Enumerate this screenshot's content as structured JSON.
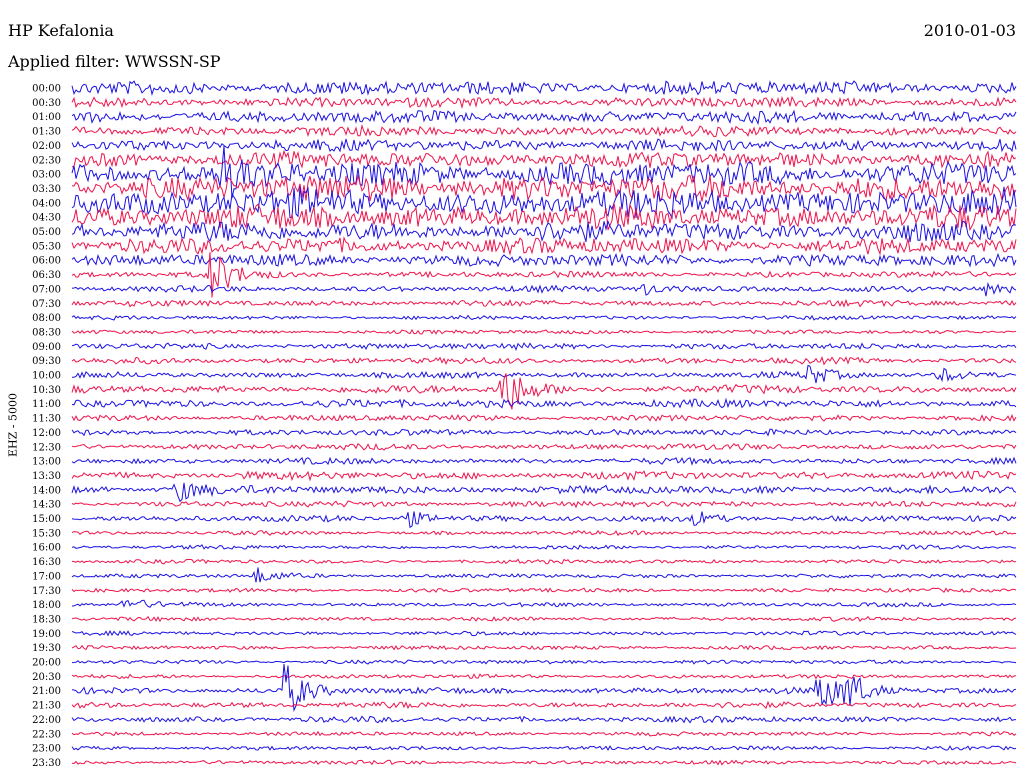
{
  "header": {
    "station": "HP Kefalonia",
    "date": "2010-01-03",
    "filter": "Applied filter: WWSSN-SP"
  },
  "channel_label": "EHZ - 5000",
  "colors": {
    "blue": "#1a10e6",
    "red": "#f0124a"
  },
  "chart_data": {
    "type": "line",
    "title": "HP Kefalonia",
    "date": "2010-01-03",
    "filter": "WWSSN-SP",
    "ylabel": "EHZ - 5000",
    "row_labels": [
      "00:00",
      "00:30",
      "01:00",
      "01:30",
      "02:00",
      "02:30",
      "03:00",
      "03:30",
      "04:00",
      "04:30",
      "05:00",
      "05:30",
      "06:00",
      "06:30",
      "07:00",
      "07:30",
      "08:00",
      "08:30",
      "09:00",
      "09:30",
      "10:00",
      "10:30",
      "11:00",
      "11:30",
      "12:00",
      "12:30",
      "13:00",
      "13:30",
      "14:00",
      "14:30",
      "15:00",
      "15:30",
      "16:00",
      "16:30",
      "17:00",
      "17:30",
      "18:00",
      "18:30",
      "19:00",
      "19:30",
      "20:00",
      "20:30",
      "21:00",
      "21:30",
      "22:00",
      "22:30",
      "23:00",
      "23:30"
    ],
    "row_noise_amplitude": [
      7,
      5,
      6,
      5,
      6,
      8,
      12,
      13,
      14,
      12,
      10,
      8,
      6,
      3,
      3,
      3,
      2,
      2,
      3,
      3,
      3,
      4,
      4,
      3,
      3,
      3,
      3,
      4,
      4,
      3,
      3,
      2,
      2,
      2,
      2,
      2,
      2,
      2,
      2,
      2,
      2,
      2,
      3,
      3,
      3,
      2,
      2,
      2
    ],
    "events": [
      {
        "row": 6,
        "position": 0.16,
        "amplitude": 20
      },
      {
        "row": 13,
        "position": 0.145,
        "amplitude": 30
      },
      {
        "row": 14,
        "position": 0.6,
        "amplitude": 8
      },
      {
        "row": 14,
        "position": 0.97,
        "amplitude": 10
      },
      {
        "row": 20,
        "position": 0.78,
        "amplitude": 10
      },
      {
        "row": 20,
        "position": 0.92,
        "amplitude": 7
      },
      {
        "row": 21,
        "position": 0.455,
        "amplitude": 35
      },
      {
        "row": 28,
        "position": 0.11,
        "amplitude": 13
      },
      {
        "row": 30,
        "position": 0.35,
        "amplitude": 12
      },
      {
        "row": 30,
        "position": 0.66,
        "amplitude": 7
      },
      {
        "row": 34,
        "position": 0.195,
        "amplitude": 8
      },
      {
        "row": 36,
        "position": 0.055,
        "amplitude": 8
      },
      {
        "row": 42,
        "position": 0.225,
        "amplitude": 30
      },
      {
        "row": 42,
        "position": 0.79,
        "amplitude": 25
      },
      {
        "row": 42,
        "position": 0.82,
        "amplitude": 20
      }
    ]
  }
}
